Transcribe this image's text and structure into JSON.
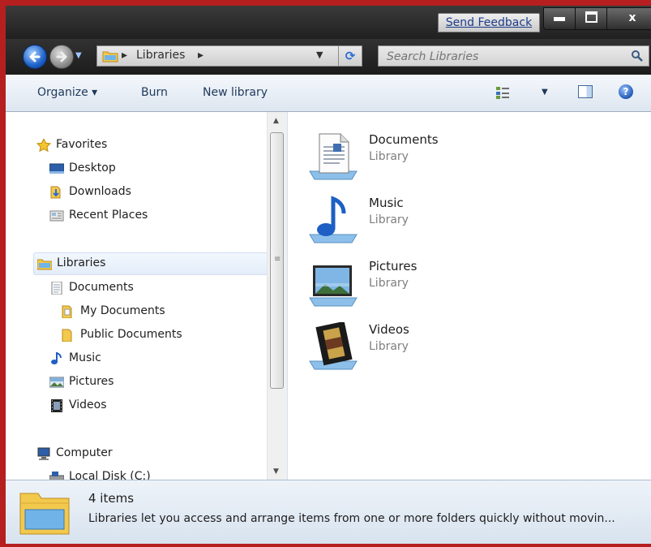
{
  "window": {
    "send_feedback": "Send Feedback",
    "min_label": "",
    "max_label": "",
    "close_label": "x"
  },
  "address": {
    "crumb_separator": "▸",
    "path": "Libraries",
    "search_placeholder": "Search Libraries"
  },
  "toolbar": {
    "organize": "Organize ▾",
    "burn": "Burn",
    "new_library": "New library",
    "help": "?"
  },
  "navpane": {
    "favorites": "Favorites",
    "desktop": "Desktop",
    "downloads": "Downloads",
    "recent_places": "Recent Places",
    "libraries": "Libraries",
    "documents": "Documents",
    "my_documents": "My Documents",
    "public_documents": "Public Documents",
    "music": "Music",
    "pictures": "Pictures",
    "videos": "Videos",
    "computer": "Computer",
    "local_disk": "Local Disk (C:)"
  },
  "libraries": [
    {
      "name": "Documents",
      "type": "Library",
      "icon": "documents-library-icon"
    },
    {
      "name": "Music",
      "type": "Library",
      "icon": "music-library-icon"
    },
    {
      "name": "Pictures",
      "type": "Library",
      "icon": "pictures-library-icon"
    },
    {
      "name": "Videos",
      "type": "Library",
      "icon": "videos-library-icon"
    }
  ],
  "details": {
    "count": "4 items",
    "description": "Libraries let you access and arrange items from one or more folders quickly without movin..."
  },
  "colors": {
    "frame_border": "#b51f1f",
    "selection": "#e3edf9",
    "link": "#1e3c8a"
  }
}
